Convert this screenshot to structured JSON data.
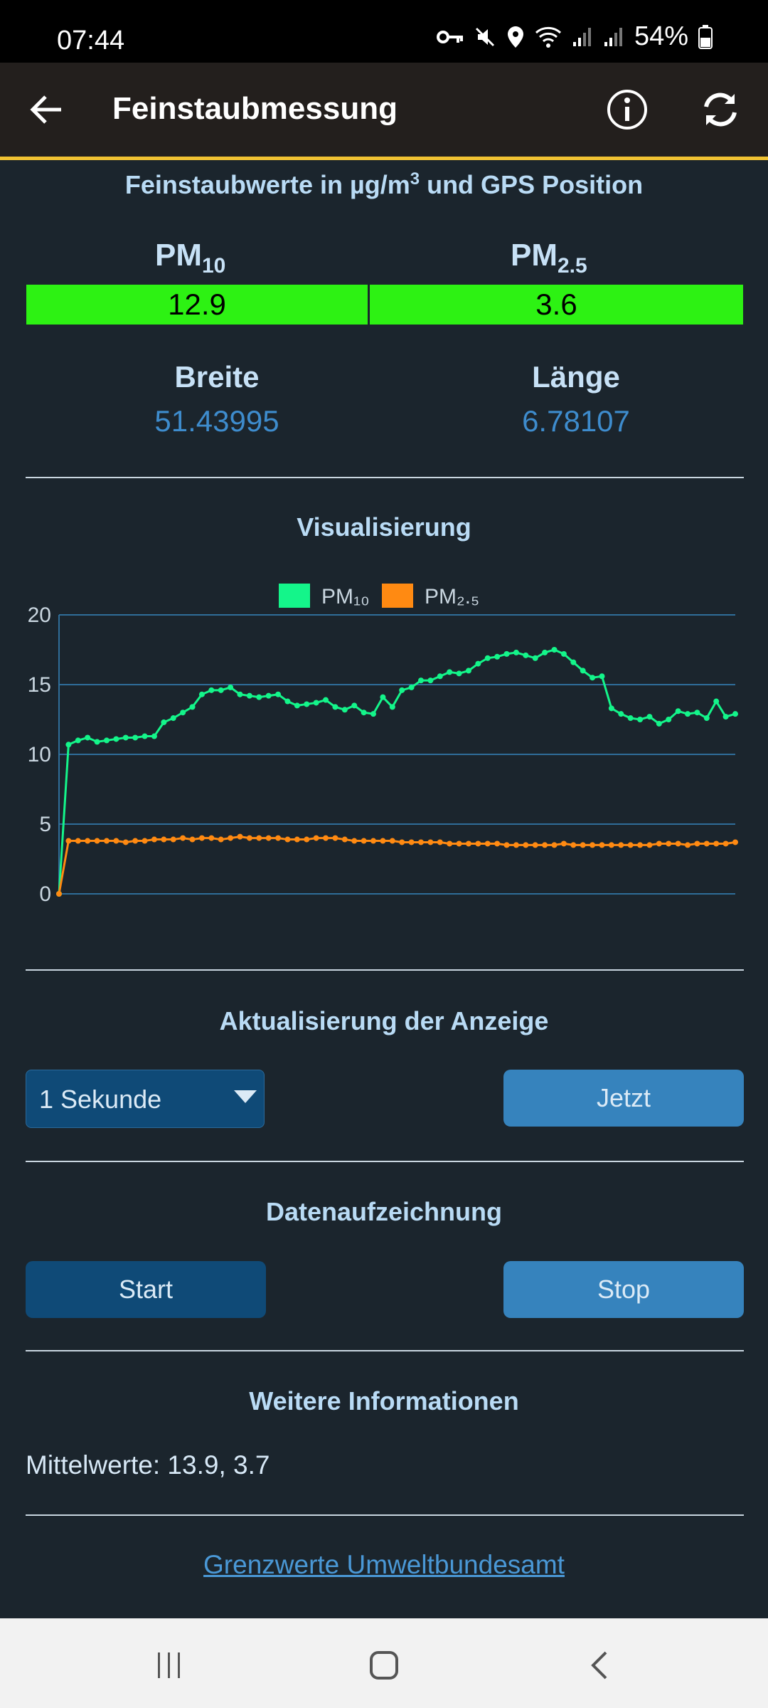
{
  "status": {
    "time": "07:44",
    "battery": "54%"
  },
  "appbar": {
    "title": "Feinstaubmessung"
  },
  "header": {
    "subtitle_main": "Feinstaubwerte in µg/m",
    "subtitle_sup": "3",
    "subtitle_end": " und GPS Position"
  },
  "pm": {
    "pm10_label": "PM",
    "pm10_sub": "10",
    "pm10_value": "12.9",
    "pm25_label": "PM",
    "pm25_sub": "2.5",
    "pm25_value": "3.6"
  },
  "gps": {
    "lat_label": "Breite",
    "lat_value": "51.43995",
    "lon_label": "Länge",
    "lon_value": "6.78107"
  },
  "sections": {
    "visual": "Visualisierung",
    "update": "Aktualisierung der Anzeige",
    "record": "Datenaufzeichnung",
    "more": "Weitere Informationen"
  },
  "update": {
    "select_value": "1 Sekunde",
    "now_button": "Jetzt"
  },
  "record": {
    "start_button": "Start",
    "stop_button": "Stop"
  },
  "info": {
    "means": "Mittelwerte: 13.9, 3.7",
    "link": "Grenzwerte Umweltbundesamt"
  },
  "colors": {
    "pm10": "#14f58a",
    "pm25": "#ff8a12",
    "good": "#2df213",
    "accent": "#f1c232"
  },
  "chart_data": {
    "type": "line",
    "title": "",
    "xlabel": "",
    "ylabel": "",
    "ylim": [
      0,
      20
    ],
    "yticks": [
      "0",
      "5",
      "10",
      "15",
      "20"
    ],
    "grid": true,
    "legend": "top-center",
    "series": [
      {
        "name": "PM₁₀",
        "color": "#14f58a",
        "values": [
          0,
          10.7,
          11.0,
          11.2,
          10.9,
          11.0,
          11.1,
          11.2,
          11.2,
          11.3,
          11.3,
          12.3,
          12.6,
          13.0,
          13.4,
          14.3,
          14.6,
          14.6,
          14.8,
          14.3,
          14.2,
          14.1,
          14.2,
          14.3,
          13.8,
          13.5,
          13.6,
          13.7,
          13.9,
          13.4,
          13.2,
          13.5,
          13.0,
          12.9,
          14.1,
          13.4,
          14.6,
          14.8,
          15.3,
          15.3,
          15.6,
          15.9,
          15.8,
          16.0,
          16.5,
          16.9,
          17.0,
          17.2,
          17.3,
          17.1,
          16.9,
          17.3,
          17.5,
          17.2,
          16.6,
          16.0,
          15.5,
          15.6,
          13.3,
          12.9,
          12.6,
          12.5,
          12.7,
          12.2,
          12.5,
          13.1,
          12.9,
          13.0,
          12.6,
          13.8,
          12.7,
          12.9
        ]
      },
      {
        "name": "PM₂.₅",
        "color": "#ff8a12",
        "values": [
          0,
          3.8,
          3.8,
          3.8,
          3.8,
          3.8,
          3.8,
          3.7,
          3.8,
          3.8,
          3.9,
          3.9,
          3.9,
          4.0,
          3.9,
          4.0,
          4.0,
          3.9,
          4.0,
          4.1,
          4.0,
          4.0,
          4.0,
          4.0,
          3.9,
          3.9,
          3.9,
          4.0,
          4.0,
          4.0,
          3.9,
          3.8,
          3.8,
          3.8,
          3.8,
          3.8,
          3.7,
          3.7,
          3.7,
          3.7,
          3.7,
          3.6,
          3.6,
          3.6,
          3.6,
          3.6,
          3.6,
          3.5,
          3.5,
          3.5,
          3.5,
          3.5,
          3.5,
          3.6,
          3.5,
          3.5,
          3.5,
          3.5,
          3.5,
          3.5,
          3.5,
          3.5,
          3.5,
          3.6,
          3.6,
          3.6,
          3.5,
          3.6,
          3.6,
          3.6,
          3.6,
          3.7
        ]
      }
    ]
  }
}
